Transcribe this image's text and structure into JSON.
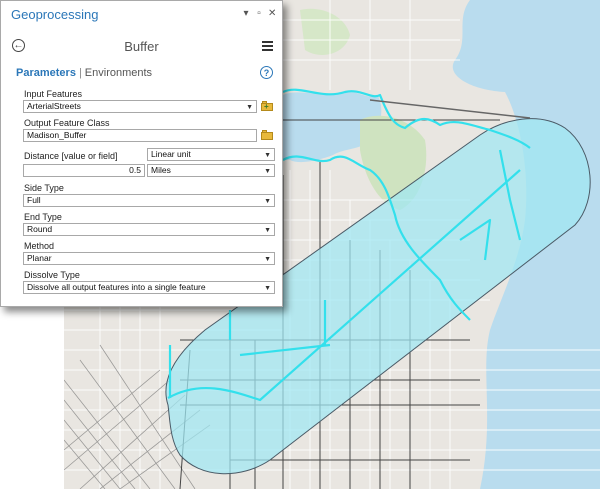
{
  "window": {
    "title": "Geoprocessing",
    "controls": [
      "pin-icon",
      "restore-icon",
      "close-icon"
    ]
  },
  "tool": {
    "back_icon": "back-arrow-icon",
    "name": "Buffer",
    "menu_icon": "hamburger-menu-icon"
  },
  "tabs": {
    "parameters": "Parameters",
    "separator": "|",
    "environments": "Environments",
    "help_icon": "?"
  },
  "params": {
    "input_features": {
      "label": "Input Features",
      "value": "ArterialStreets"
    },
    "output_feature_class": {
      "label": "Output Feature Class",
      "value": "Madison_Buffer"
    },
    "distance": {
      "label": "Distance [value or field]",
      "type": "Linear unit",
      "value": "0.5",
      "unit": "Miles"
    },
    "side_type": {
      "label": "Side Type",
      "value": "Full"
    },
    "end_type": {
      "label": "End Type",
      "value": "Round"
    },
    "method": {
      "label": "Method",
      "value": "Planar"
    },
    "dissolve_type": {
      "label": "Dissolve Type",
      "value": "Dissolve all output features into a single feature"
    }
  },
  "colors": {
    "accent": "#2b77b8",
    "buffer_fill": "#9fe8f2",
    "buffer_stroke": "#4a5a66",
    "highlight_line": "#33e0ec",
    "water": "#b9dcee",
    "land": "#e9e6e1",
    "park": "#cfe3c0"
  }
}
